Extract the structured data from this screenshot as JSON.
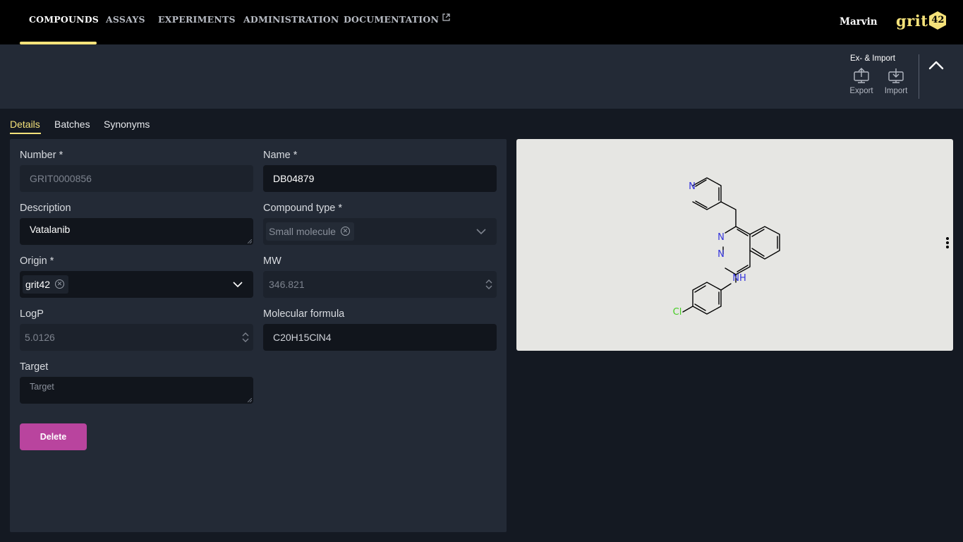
{
  "nav": {
    "items": [
      {
        "label": "COMPOUNDS",
        "active": true
      },
      {
        "label": "ASSAYS"
      },
      {
        "label": "EXPERIMENTS"
      },
      {
        "label": "ADMINISTRATION"
      },
      {
        "label": "DOCUMENTATION",
        "external": true
      }
    ],
    "user": "Marvin",
    "logo_text": "grit",
    "logo_badge": "42"
  },
  "toolbar": {
    "group_label": "Ex- & Import",
    "export_label": "Export",
    "import_label": "Import",
    "collapse_icon": "chevron-up-icon"
  },
  "tabs": [
    "Details",
    "Batches",
    "Synonyms"
  ],
  "form": {
    "number": {
      "label": "Number *",
      "value": "GRIT0000856"
    },
    "name": {
      "label": "Name *",
      "value": "DB04879"
    },
    "description": {
      "label": "Description",
      "value": "Vatalanib"
    },
    "compound_type": {
      "label": "Compound type *",
      "value": "Small molecule"
    },
    "origin": {
      "label": "Origin *",
      "value": "grit42"
    },
    "mw": {
      "label": "MW",
      "value": "346.821"
    },
    "logp": {
      "label": "LogP",
      "value": "5.0126"
    },
    "molecular_formula": {
      "label": "Molecular formula",
      "value": "C20H15ClN4"
    },
    "target": {
      "label": "Target",
      "placeholder": "Target"
    },
    "delete_label": "Delete"
  },
  "structure": {
    "atoms": {
      "n1": "N",
      "n2": "N",
      "n3": "N",
      "nh": "NH",
      "cl": "Cl"
    },
    "colors": {
      "nitrogen": "#3333dd",
      "chlorine": "#44cc22",
      "bond": "#000000"
    }
  },
  "colors": {
    "accent": "#f5e27a",
    "delete": "#b9449e",
    "nav_bg": "#000000",
    "panel_bg": "#232a36",
    "page_bg": "#141922"
  }
}
